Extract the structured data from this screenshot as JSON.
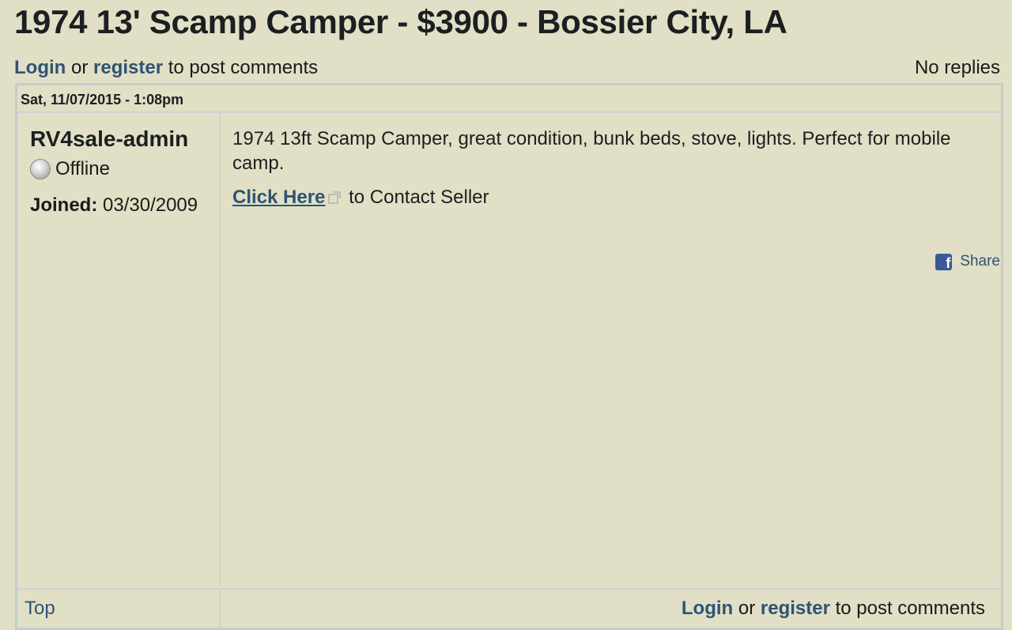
{
  "page": {
    "title": "1974 13' Scamp Camper - $3900 - Bossier City, LA"
  },
  "auth": {
    "login": "Login",
    "or": " or ",
    "register": "register",
    "suffix": " to post comments"
  },
  "replies": "No replies",
  "post": {
    "date": "Sat, 11/07/2015 - 1:08pm",
    "author": {
      "name": "RV4sale-admin",
      "status": "Offline",
      "joined_label": "Joined:",
      "joined_value": " 03/30/2009"
    },
    "body": "1974 13ft Scamp Camper, great condition, bunk beds, stove, lights. Perfect for mobile camp.",
    "contact_link": "Click Here",
    "contact_suffix": " to Contact Seller",
    "share_label": "Share",
    "fb_glyph": "f"
  },
  "footer": {
    "top_link": "Top"
  },
  "icons": {
    "status": "offline-orb-icon",
    "external": "external-link-icon",
    "share": "facebook-icon"
  }
}
